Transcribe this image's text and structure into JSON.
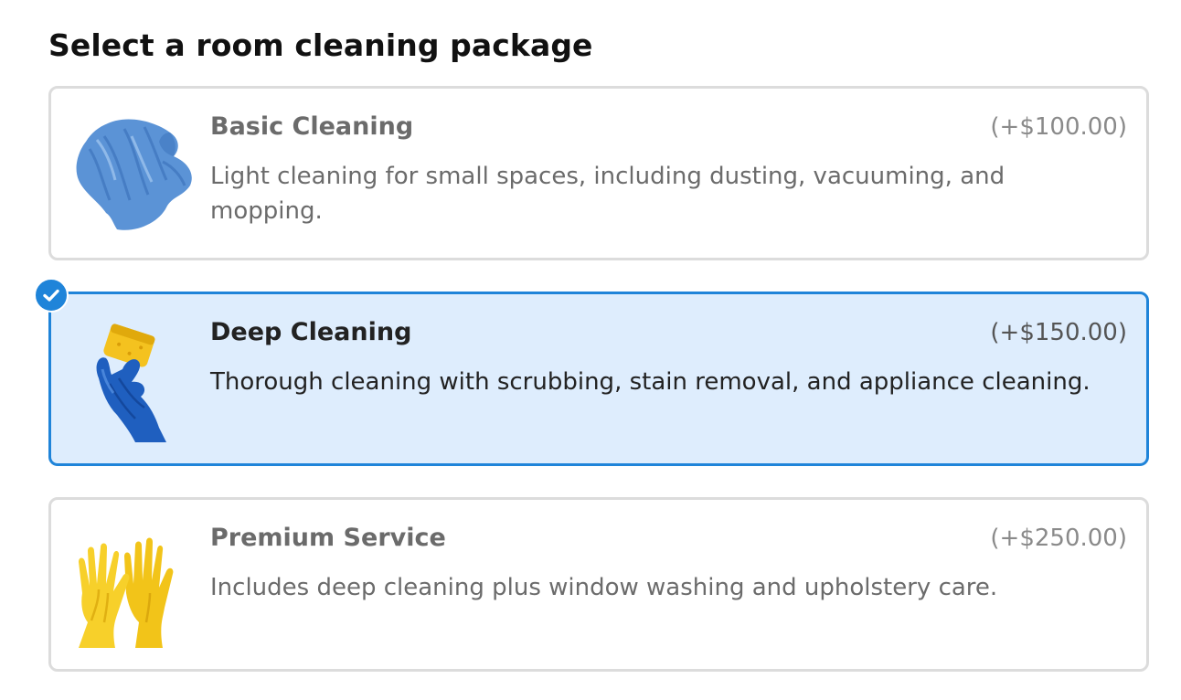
{
  "heading": "Select a room cleaning package",
  "selected_package": "Deep Cleaning",
  "colors": {
    "accent": "#1f84d9",
    "selected_background": "#deedfd",
    "card_border": "#dcdcdc"
  },
  "packages": [
    {
      "title": "Basic Cleaning",
      "price": "(+$100.00)",
      "description": "Light cleaning for small spaces, including dusting, vacuuming, and mopping.",
      "image": "blue-microfiber-cloth"
    },
    {
      "title": "Deep Cleaning",
      "price": "(+$150.00)",
      "description": "Thorough cleaning with scrubbing, stain removal, and appliance cleaning.",
      "image": "gloved-hand-with-sponge",
      "selected_indicator": "checkmark-icon"
    },
    {
      "title": "Premium Service",
      "price": "(+$250.00)",
      "description": "Includes deep cleaning plus window washing and upholstery care.",
      "image": "yellow-rubber-gloves"
    }
  ]
}
